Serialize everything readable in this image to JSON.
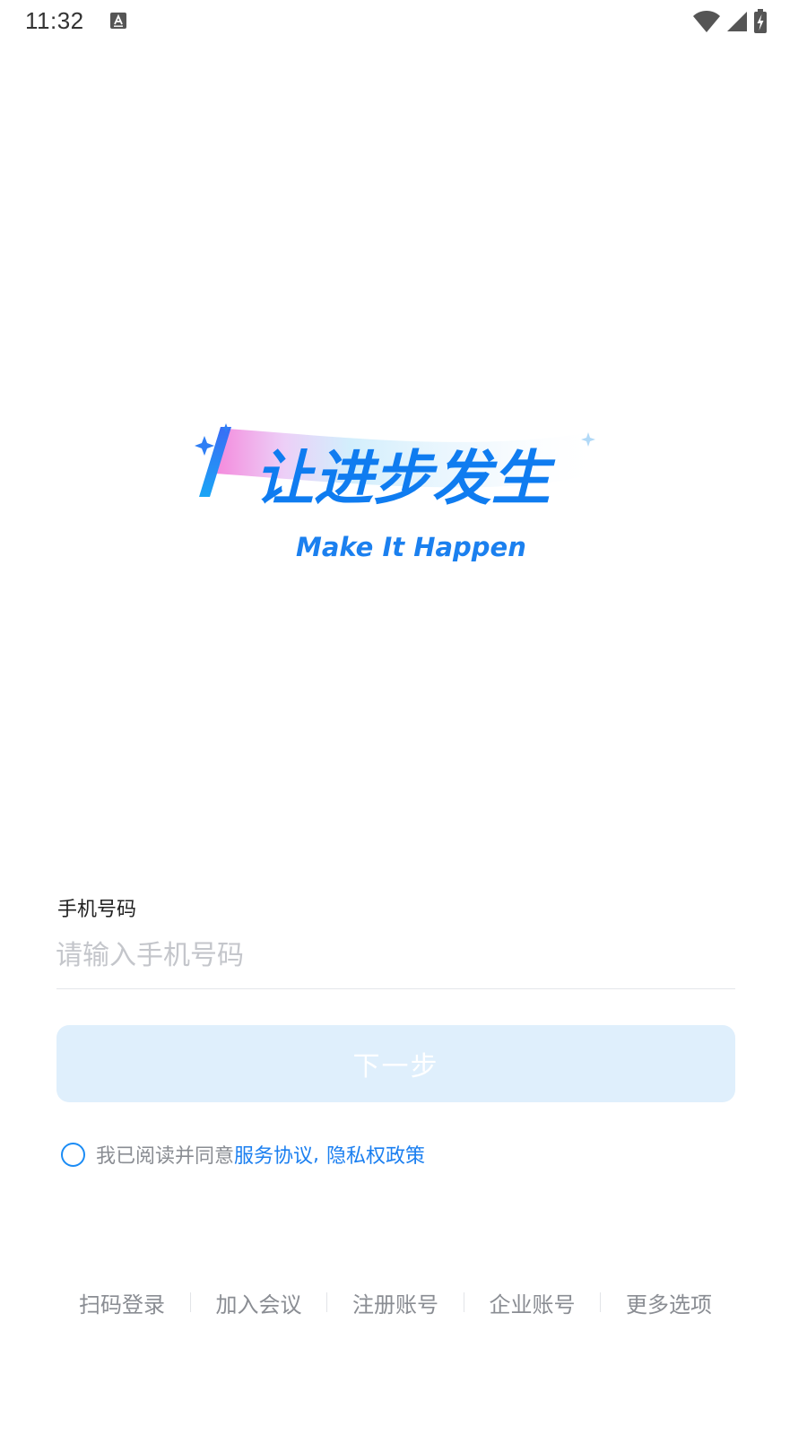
{
  "status_bar": {
    "time": "11:32",
    "icons": [
      "a-notification-icon",
      "wifi-icon",
      "signal-icon",
      "battery-charging-icon"
    ]
  },
  "logo": {
    "slogan": "让进步发生",
    "tagline": "Make It Happen",
    "brand_color": "#0f7cf0"
  },
  "login": {
    "phone_label": "手机号码",
    "phone_placeholder": "请输入手机号码",
    "phone_value": "",
    "next_button": "下一步"
  },
  "agreement": {
    "prefix": "我已阅读并同意",
    "service_link": "服务协议",
    "separator": ",",
    "privacy_link": "隐私权政策",
    "checked": false
  },
  "bottom_options": [
    "扫码登录",
    "加入会议",
    "注册账号",
    "企业账号",
    "更多选项"
  ],
  "colors": {
    "accent": "#1b7ff0",
    "button_disabled_bg": "#dfeffc",
    "muted_text": "#8a8d93",
    "placeholder": "#c4c6cb"
  }
}
